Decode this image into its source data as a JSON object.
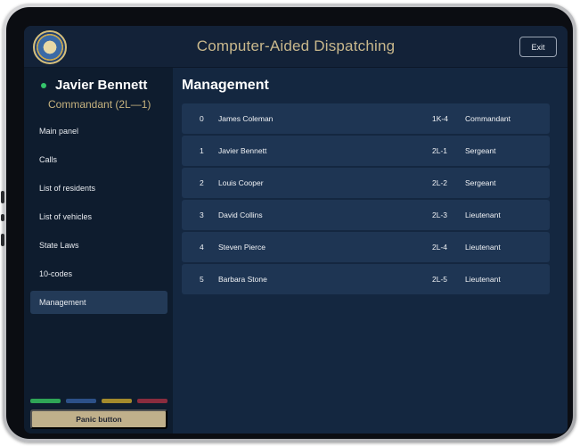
{
  "app": {
    "title": "Computer-Aided Dispatching",
    "exit_label": "Exit",
    "seal_icon": "state-seal-icon"
  },
  "user": {
    "name": "Javier Bennett",
    "rank": "Commandant (2L—1)",
    "status_color": "#35c46b"
  },
  "sidebar": {
    "items": [
      {
        "label": "Main panel",
        "active": false
      },
      {
        "label": "Calls",
        "active": false
      },
      {
        "label": "List of residents",
        "active": false
      },
      {
        "label": "List of vehicles",
        "active": false
      },
      {
        "label": "State Laws",
        "active": false
      },
      {
        "label": "10-codes",
        "active": false
      },
      {
        "label": "Management",
        "active": true
      }
    ],
    "status_colors": [
      "#2fa556",
      "#2c5088",
      "#a38a2c",
      "#8a2c3e"
    ],
    "panic_label": "Panic button"
  },
  "main": {
    "title": "Management",
    "rows": [
      {
        "index": "0",
        "name": "James Coleman",
        "code": "1K-4",
        "rank": "Commandant"
      },
      {
        "index": "1",
        "name": "Javier Bennett",
        "code": "2L-1",
        "rank": "Sergeant"
      },
      {
        "index": "2",
        "name": "Louis Cooper",
        "code": "2L-2",
        "rank": "Sergeant"
      },
      {
        "index": "3",
        "name": "David Collins",
        "code": "2L-3",
        "rank": "Lieutenant"
      },
      {
        "index": "4",
        "name": "Steven Pierce",
        "code": "2L-4",
        "rank": "Lieutenant"
      },
      {
        "index": "5",
        "name": "Barbara Stone",
        "code": "2L-5",
        "rank": "Lieutenant"
      }
    ]
  }
}
